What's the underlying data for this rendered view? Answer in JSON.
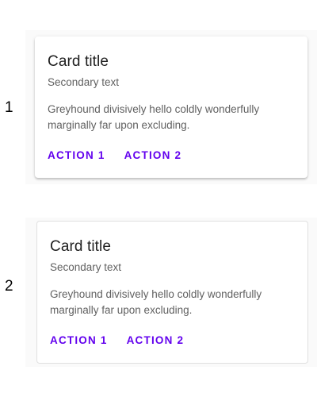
{
  "rows": [
    {
      "label": "1",
      "variant": "elevated",
      "card": {
        "title": "Card title",
        "subtitle": "Secondary text",
        "body": "Greyhound divisively hello coldly wonderfully marginally far upon excluding.",
        "actions": [
          "ACTION 1",
          "ACTION 2"
        ]
      }
    },
    {
      "label": "2",
      "variant": "outlined",
      "card": {
        "title": "Card title",
        "subtitle": "Secondary text",
        "body": "Greyhound divisively hello coldly wonderfully marginally far upon excluding.",
        "actions": [
          "ACTION 1",
          "ACTION 2"
        ]
      }
    }
  ],
  "colors": {
    "accent": "#6200ee",
    "title": "#212121",
    "secondary_text": "#616161",
    "panel_background": "#fafafa",
    "outline": "#e0e0e0"
  }
}
